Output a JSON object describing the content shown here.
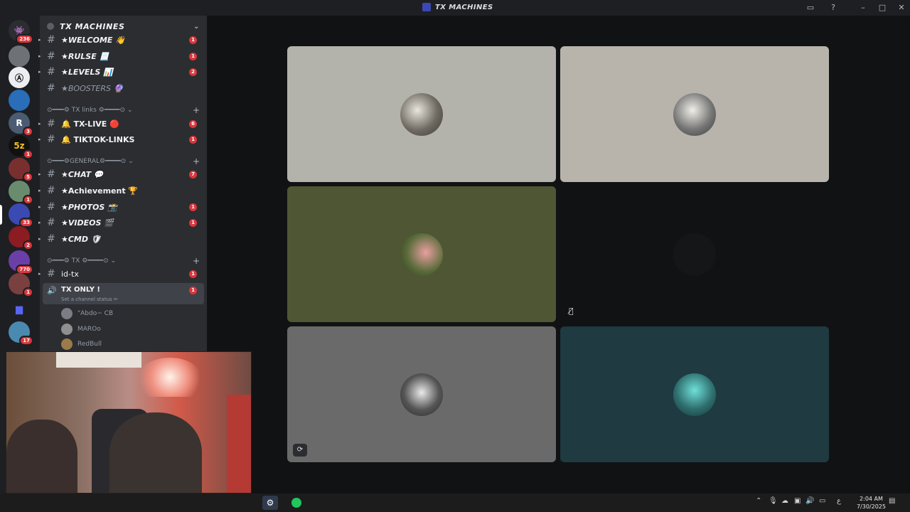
{
  "window": {
    "title": "TX MACHINES"
  },
  "guilds": [
    {
      "badge": "236"
    },
    {
      "badge": ""
    },
    {
      "badge": ""
    },
    {
      "badge": ""
    },
    {
      "label": "R",
      "badge": "3"
    },
    {
      "label": "5z",
      "badge": "1"
    },
    {
      "badge": "5"
    },
    {
      "badge": "1"
    },
    {
      "badge": "33"
    },
    {
      "badge": "2"
    },
    {
      "badge": "770"
    },
    {
      "badge": "1"
    },
    {
      "badge": ""
    },
    {
      "badge": "17"
    }
  ],
  "server": {
    "name": "TX MACHINES"
  },
  "channels": [
    {
      "name": "★WELCOME 👋",
      "unread": "1"
    },
    {
      "name": "★RULSE 📃",
      "unread": "1"
    },
    {
      "name": "★LEVELS 📊",
      "unread": "2"
    },
    {
      "name": "★BOOSTERS 🔮",
      "unread": ""
    },
    {
      "name": "🔔 TX-LIVE 🔴",
      "unread": "6"
    },
    {
      "name": "🔔 TIKTOK-LINKS",
      "unread": "1"
    },
    {
      "name": "★CHAT 💬",
      "unread": "7"
    },
    {
      "name": "★Achievement 🏆",
      "unread": ""
    },
    {
      "name": "★PHOTOS 📸",
      "unread": "1"
    },
    {
      "name": "★VIDEOS 🎬",
      "unread": "1"
    },
    {
      "name": "★CMD 🛡",
      "unread": ""
    },
    {
      "name": "id-tx",
      "unread": "1"
    }
  ],
  "categories": [
    {
      "name": "⊙━━━⚙ TX links ⚙━━━━⊙"
    },
    {
      "name": "⊙━━━⚙GENERAL⚙━━━━⊙"
    },
    {
      "name": "⊙━━━⚙ TX ⚙━━━━⊙"
    }
  ],
  "voice_channel": {
    "name": "TX ONLY !",
    "status": "Set a channel status ✏",
    "unread": "1"
  },
  "voice_users": [
    {
      "name": "\"Abdo~ CB"
    },
    {
      "name": "MAROo"
    },
    {
      "name": "RedBull"
    }
  ],
  "colors": {
    "tile1": "#b4b3ab",
    "tile2": "#b8b4ac",
    "tile3": "#4f5634",
    "tile4": "#111214",
    "tile5": "#6a6a6a",
    "tile6": "#1f3a40",
    "accent": "#da373c"
  },
  "taskbar": {
    "time": "2:04 AM",
    "date": "7/30/2025",
    "lang": "ع"
  }
}
